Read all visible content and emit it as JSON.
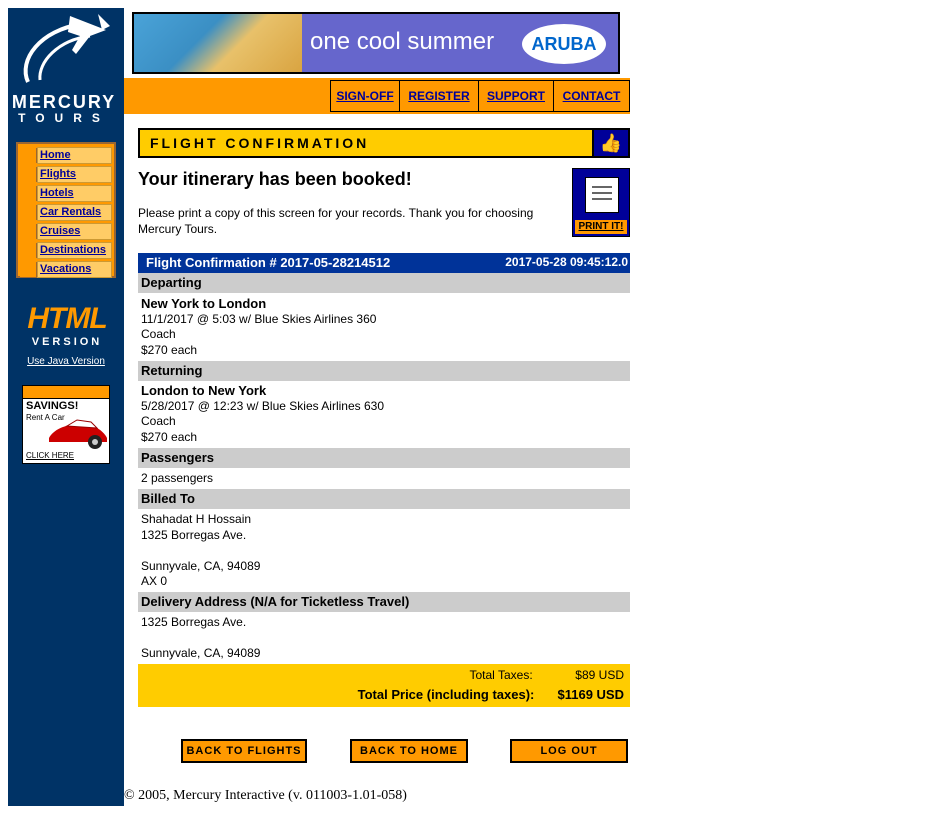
{
  "brand": {
    "name_line1": "MERCURY",
    "name_line2": "TOURS"
  },
  "side_nav": [
    {
      "label": "Home"
    },
    {
      "label": "Flights"
    },
    {
      "label": "Hotels"
    },
    {
      "label": "Car Rentals"
    },
    {
      "label": "Cruises"
    },
    {
      "label": "Destinations"
    },
    {
      "label": "Vacations"
    }
  ],
  "html_version": {
    "line1": "HTML",
    "line2": "VERSION",
    "java_link": "Use Java Version"
  },
  "ad": {
    "headline": "SAVINGS!",
    "sub": "Rent A Car",
    "cta": "CLICK HERE"
  },
  "banner": {
    "tagline": "one cool summer",
    "logo_text": "ARUBA"
  },
  "top_links": [
    "SIGN-OFF",
    "REGISTER",
    "SUPPORT",
    "CONTACT"
  ],
  "page": {
    "header": "FLIGHT CONFIRMATION",
    "booked": "Your itinerary has been booked!",
    "note": "Please print a copy of this screen for your records. Thank you for choosing Mercury Tours.",
    "print_label": "PRINT IT!"
  },
  "confirmation": {
    "number_label": "Flight Confirmation # 2017-05-28214512",
    "timestamp": "2017-05-28 09:45:12.0",
    "departing": {
      "heading": "Departing",
      "route": "New York to London",
      "flight": "11/1/2017 @ 5:03 w/ Blue Skies Airlines 360",
      "class": "Coach",
      "price": "$270 each"
    },
    "returning": {
      "heading": "Returning",
      "route": "London to New York",
      "flight": "5/28/2017 @ 12:23 w/ Blue Skies Airlines 630",
      "class": "Coach",
      "price": "$270 each"
    },
    "passengers": {
      "heading": "Passengers",
      "value": "2 passengers"
    },
    "billed_to": {
      "heading": "Billed To",
      "name": "Shahadat H Hossain",
      "address": "1325 Borregas Ave.",
      "city": "Sunnyvale, CA, 94089",
      "card": "AX 0"
    },
    "delivery": {
      "heading": "Delivery Address (N/A for Ticketless Travel)",
      "address": "1325 Borregas Ave.",
      "city": "Sunnyvale, CA, 94089"
    },
    "taxes_label": "Total Taxes:",
    "taxes_value": "$89 USD",
    "total_label": "Total Price (including taxes):",
    "total_value": "$1169 USD"
  },
  "buttons": {
    "back_flights": "BACK TO FLIGHTS",
    "back_home": "BACK TO HOME",
    "logout": "LOG OUT"
  },
  "footer": "© 2005, Mercury Interactive (v. 011003-1.01-058)"
}
